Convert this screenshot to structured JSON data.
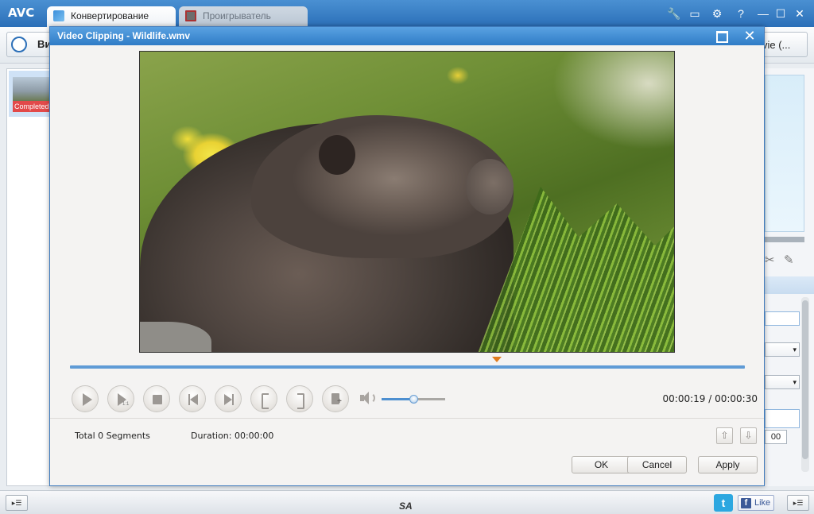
{
  "app": {
    "logo": "AVC",
    "tabs": [
      {
        "label": "Конвертирование",
        "active": true
      },
      {
        "label": "Проигрыватель",
        "active": false
      }
    ],
    "window_controls": {
      "search": "🔧",
      "monitor": "▭",
      "settings": "⚙",
      "help": "?",
      "minimize": "—",
      "maximize": "☐",
      "close": "✕"
    }
  },
  "toolbar": {
    "add_video_label": "Ви",
    "profile_value": "vie (..."
  },
  "file_list": {
    "items": [
      {
        "status": "Completed"
      }
    ]
  },
  "right_panel": {
    "number_value": "00"
  },
  "statusbar": {
    "left_button": "▸☰",
    "right_button": "▸☰",
    "center_logo": "SA",
    "twitter_glyph": "t",
    "fb_glyph": "f",
    "fb_like_label": "Like"
  },
  "dialog": {
    "title": "Video Clipping - Wildlife.wmv",
    "close_glyph": "✕",
    "timeline_position": 0.633,
    "volume_level": 0.5,
    "time_current": "00:00:19",
    "time_total": "00:00:30",
    "time_separator": " / ",
    "segments_label": "Total 0 Segments",
    "duration_label": "Duration: 00:00:00",
    "move_up_glyph": "⇧",
    "move_down_glyph": "⇩",
    "buttons": {
      "ok": "OK",
      "cancel": "Cancel",
      "apply": "Apply"
    }
  },
  "colors": {
    "titlebar": "#2b6fb8",
    "dialog_titlebar": "#2f7cc6",
    "timeline": "#5f9bd6",
    "marker": "#e07b1d",
    "completed_badge": "#e24a4a"
  }
}
